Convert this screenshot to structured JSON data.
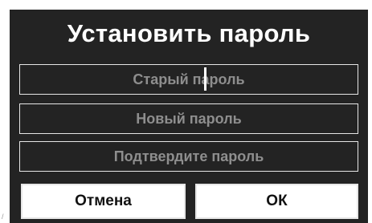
{
  "dialog": {
    "title": "Установить пароль",
    "fields": {
      "old_password": {
        "placeholder": "Старый пароль",
        "value": ""
      },
      "new_password": {
        "placeholder": "Новый пароль",
        "value": ""
      },
      "confirm_password": {
        "placeholder": "Подтвердите пароль",
        "value": ""
      }
    },
    "buttons": {
      "cancel_label": "Отмена",
      "ok_label": "ОК"
    }
  },
  "colors": {
    "dialog_background": "#232323",
    "title_text": "#ffffff",
    "placeholder_text": "#8e8e8e",
    "border": "#e6e6e6",
    "button_background": "#ffffff",
    "button_text": "#111111"
  }
}
